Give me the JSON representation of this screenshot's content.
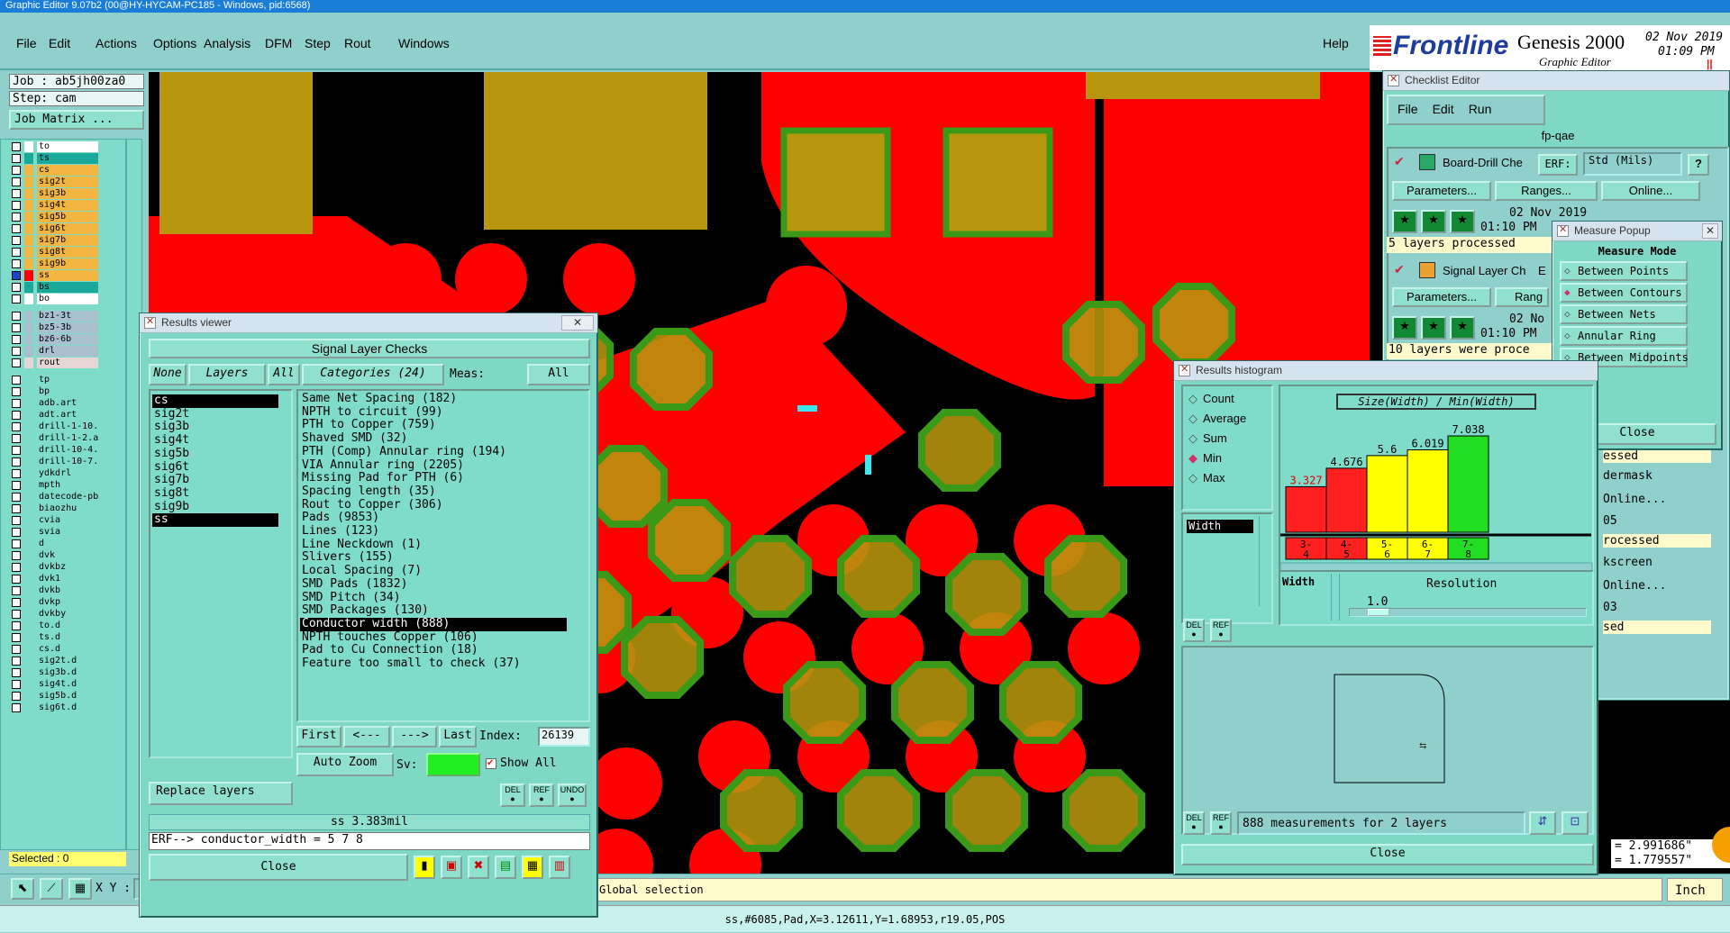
{
  "app": {
    "title": "Graphic Editor 9.07b2 (00@HY-HYCAM-PC185 - Windows, pid:6568)"
  },
  "menu": [
    "File",
    "Edit",
    "Actions",
    "Options",
    "Analysis",
    "DFM",
    "Step",
    "Rout",
    "Windows"
  ],
  "help": "Help",
  "brand": {
    "logo": "Frontline",
    "product": "Genesis 2000",
    "sub": "Graphic Editor",
    "date": "02 Nov 2019",
    "time": "01:09 PM"
  },
  "job": {
    "job": "Job : ab5jh00za0",
    "step": "Step: cam",
    "matrix": "Job Matrix ..."
  },
  "layers": [
    {
      "name": "to",
      "color": "#ffffff"
    },
    {
      "name": "ts",
      "color": "#1aa89a"
    },
    {
      "name": "cs",
      "color": "#f2b640"
    },
    {
      "name": "sig2t",
      "color": "#f2b640"
    },
    {
      "name": "sig3b",
      "color": "#f2b640"
    },
    {
      "name": "sig4t",
      "color": "#f2b640"
    },
    {
      "name": "sig5b",
      "color": "#f2b640"
    },
    {
      "name": "sig6t",
      "color": "#f2b640"
    },
    {
      "name": "sig7b",
      "color": "#f2b640"
    },
    {
      "name": "sig8t",
      "color": "#f2b640"
    },
    {
      "name": "sig9b",
      "color": "#f2b640"
    },
    {
      "name": "ss",
      "color": "#f2b640"
    },
    {
      "name": "bs",
      "color": "#1aa89a"
    },
    {
      "name": "bo",
      "color": "#ffffff"
    },
    {
      "name": "bz1-3t",
      "color": "#a8c0d0"
    },
    {
      "name": "bz5-3b",
      "color": "#a8c0d0"
    },
    {
      "name": "bz6-6b",
      "color": "#a8c0d0"
    },
    {
      "name": "drl",
      "color": "#a8c0d0"
    },
    {
      "name": "rout",
      "color": "#e6d6d6"
    },
    {
      "name": "tp",
      "color": "#7fdccb"
    },
    {
      "name": "bp",
      "color": "#7fdccb"
    },
    {
      "name": "adb.art",
      "color": "#7fdccb"
    },
    {
      "name": "adt.art",
      "color": "#7fdccb"
    },
    {
      "name": "drill-1-10.",
      "color": "#7fdccb"
    },
    {
      "name": "drill-1-2.a",
      "color": "#7fdccb"
    },
    {
      "name": "drill-10-4.",
      "color": "#7fdccb"
    },
    {
      "name": "drill-10-7.",
      "color": "#7fdccb"
    },
    {
      "name": "ydkdrl",
      "color": "#7fdccb"
    },
    {
      "name": "mpth",
      "color": "#7fdccb"
    },
    {
      "name": "datecode-pb",
      "color": "#7fdccb"
    },
    {
      "name": "biaozhu",
      "color": "#7fdccb"
    },
    {
      "name": "cvia",
      "color": "#7fdccb"
    },
    {
      "name": "svia",
      "color": "#7fdccb"
    },
    {
      "name": "d",
      "color": "#7fdccb"
    },
    {
      "name": "dvk",
      "color": "#7fdccb"
    },
    {
      "name": "dvkbz",
      "color": "#7fdccb"
    },
    {
      "name": "dvk1",
      "color": "#7fdccb"
    },
    {
      "name": "dvkb",
      "color": "#7fdccb"
    },
    {
      "name": "dvkp",
      "color": "#7fdccb"
    },
    {
      "name": "dvkby",
      "color": "#7fdccb"
    },
    {
      "name": "to.d",
      "color": "#7fdccb"
    },
    {
      "name": "ts.d",
      "color": "#7fdccb"
    },
    {
      "name": "cs.d",
      "color": "#7fdccb"
    },
    {
      "name": "sig2t.d",
      "color": "#7fdccb"
    },
    {
      "name": "sig3b.d",
      "color": "#7fdccb"
    },
    {
      "name": "sig4t.d",
      "color": "#7fdccb"
    },
    {
      "name": "sig5b.d",
      "color": "#7fdccb"
    },
    {
      "name": "sig6t.d",
      "color": "#7fdccb"
    }
  ],
  "selected": "Selected : 0",
  "xy_label": "X Y :",
  "status_left": "Global selection",
  "status_bottom": "ss,#6085,Pad,X=3.12611,Y=1.68953,r19.05,POS",
  "units": "Inch",
  "coords": {
    "x": "= 2.991686\"",
    "y": "= 1.779557\""
  },
  "results": {
    "title": "Results viewer",
    "header": "Signal Layer Checks",
    "none": "None",
    "layers": "Layers",
    "all": "All",
    "categories_label": "Categories (24)",
    "meas_label": "Meas:",
    "meas_value": "All",
    "layer_list": [
      "cs",
      "sig2t",
      "sig3b",
      "sig4t",
      "sig5b",
      "sig6t",
      "sig7b",
      "sig8t",
      "sig9b",
      "ss"
    ],
    "categories": [
      "Same Net Spacing (182)",
      "NPTH to circuit (99)",
      "PTH to Copper (759)",
      "Shaved SMD (32)",
      "PTH (Comp) Annular ring (194)",
      "VIA Annular ring (2205)",
      "Missing Pad for PTH (6)",
      "Spacing length (35)",
      "Rout to Copper (306)",
      "Pads (9853)",
      "Lines (123)",
      "Line Neckdown (1)",
      "Slivers (155)",
      "Local Spacing (7)",
      "SMD Pads (1832)",
      "SMD Pitch (34)",
      "SMD Packages (130)",
      "Conductor width (888)",
      "NPTH touches Copper (106)",
      "Pad to Cu Connection (18)",
      "Feature too small to check (37)"
    ],
    "first": "First",
    "prev": "<---",
    "next": "--->",
    "last": "Last",
    "index_label": "Index:",
    "index": "26139",
    "autozoom": "Auto Zoom",
    "sv": "Sv:",
    "showall": "Show All",
    "replace": "Replace layers",
    "del": "DEL",
    "ref": "REF",
    "undo": "UNDO",
    "value": "ss 3.383mil",
    "erf": "ERF--> conductor_width = 5 7 8",
    "close": "Close"
  },
  "checklist": {
    "title": "Checklist Editor",
    "menu": [
      "File",
      "Edit",
      "Run"
    ],
    "name": "fp-qae",
    "row1": "Board-Drill Che",
    "erf": "ERF:",
    "std": "Std (Mils)",
    "params": "Parameters...",
    "ranges": "Ranges...",
    "online": "Online...",
    "ranges2": "Rang",
    "date1": "02 Nov 2019",
    "time1": "01:10 PM",
    "proc1": "5 layers processed",
    "row2": "Signal Layer Ch",
    "el": "E",
    "date2": "02 No",
    "time2": "01:10 PM",
    "proc2": "10 layers were proce",
    "frag": [
      "essed",
      "dermask",
      "Online...",
      "05",
      "rocessed",
      "kscreen",
      "Online...",
      "03",
      "sed"
    ]
  },
  "measure": {
    "title": "Measure Popup",
    "header": "Measure Mode",
    "items": [
      "Between Points",
      "Between Contours",
      "Between Nets",
      "Annular Ring",
      "Between Midpoints"
    ],
    "selected": 1,
    "close": "Close"
  },
  "histogram": {
    "title": "Results histogram",
    "modes": [
      "Count",
      "Average",
      "Sum",
      "Min",
      "Max"
    ],
    "mode_selected": 3,
    "list_item": "Width",
    "chart_title": "Size(Width) / Min(Width)",
    "resolution_label": "Resolution",
    "resolution": "1.0",
    "width_tag": "Width",
    "footer": "888 measurements for 2 layers",
    "close": "Close"
  },
  "chart_data": {
    "type": "bar",
    "title": "Size(Width) / Min(Width)",
    "categories": [
      "3-4",
      "4-5",
      "5-6",
      "6-7",
      "7-8"
    ],
    "values": [
      3.327,
      4.676,
      5.6,
      6.019,
      7.038
    ],
    "colors": [
      "#ff2020",
      "#ff2020",
      "#ffff00",
      "#ffff00",
      "#22dd22"
    ],
    "ylim": [
      0,
      7.6
    ]
  }
}
